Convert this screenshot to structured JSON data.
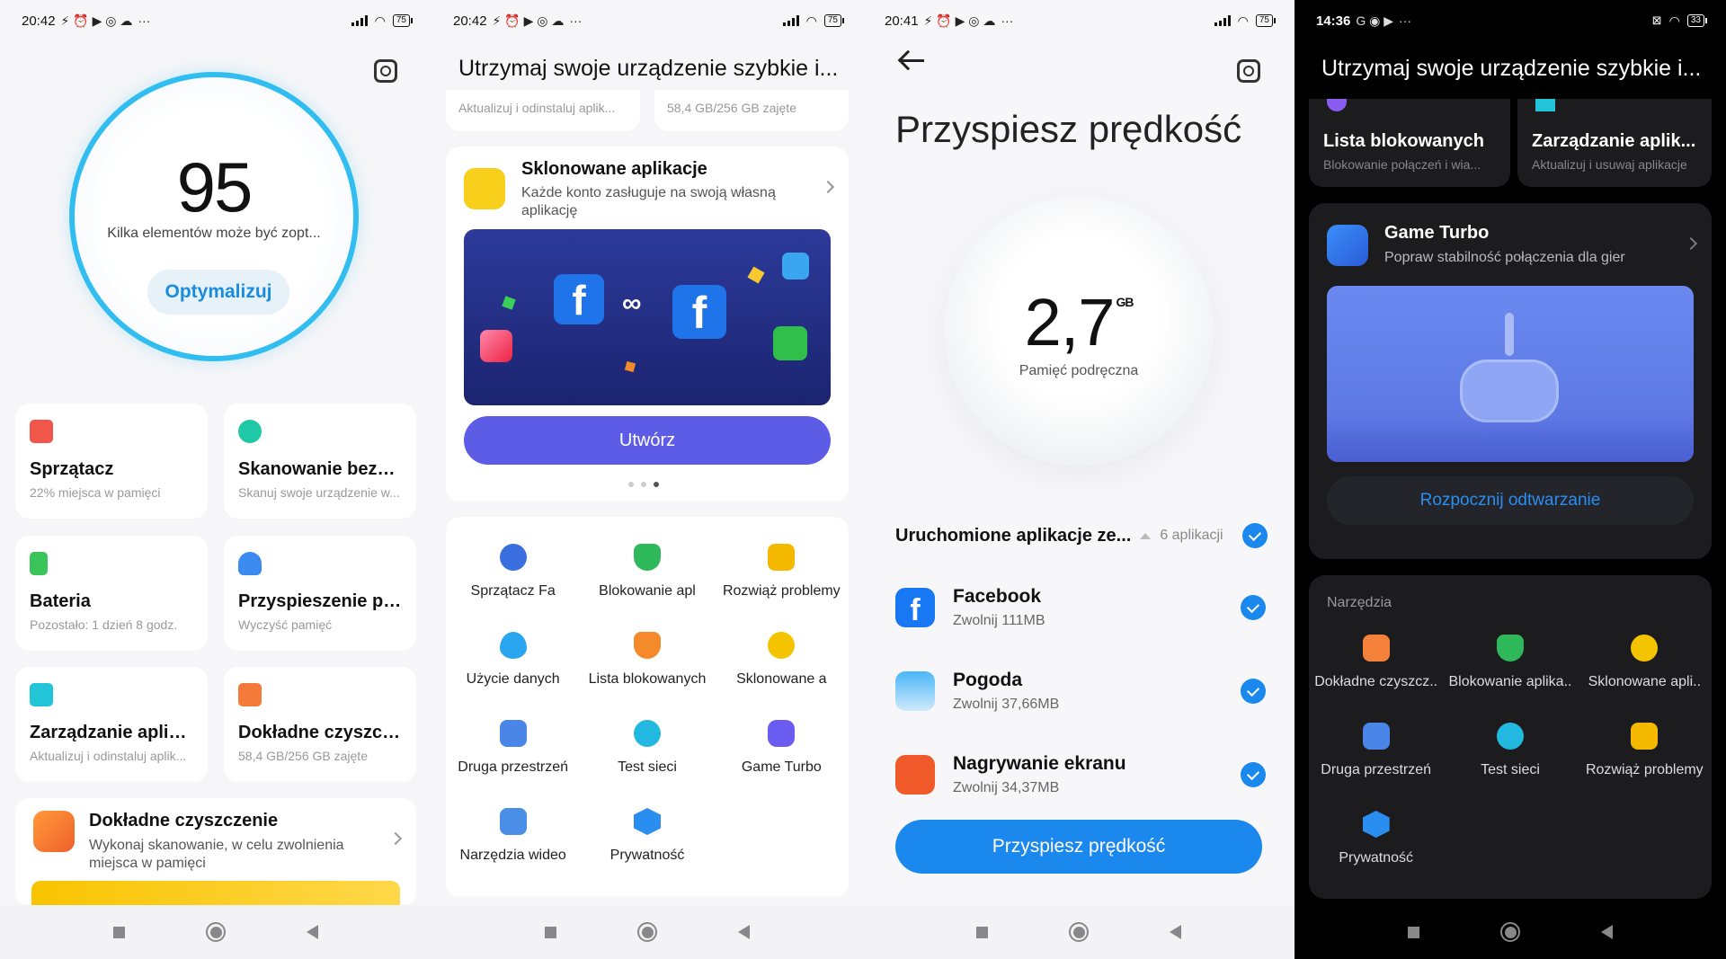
{
  "status_bar": {
    "p1_time": "20:42",
    "p2_time": "20:42",
    "p3_time": "20:41",
    "p4_time": "14:36",
    "battery_light": "75",
    "battery_dark": "33",
    "more": "···"
  },
  "panel1": {
    "score": "95",
    "score_subtitle": "Kilka elementów może być zopt...",
    "optimize_button": "Optymalizuj",
    "tiles": [
      {
        "title": "Sprzątacz",
        "subtitle": "22% miejsca w pamięci",
        "color": "#f0574a"
      },
      {
        "title": "Skanowanie bezpi...",
        "subtitle": "Skanuj swoje urządzenie w...",
        "color": "#1fc8a6"
      },
      {
        "title": "Bateria",
        "subtitle": "Pozostało: 1 dzień 8 godz.",
        "color": "#3ac45a"
      },
      {
        "title": "Przyspieszenie pr...",
        "subtitle": "Wyczyść pamięć",
        "color": "#3b8bf0"
      },
      {
        "title": "Zarządzanie aplik...",
        "subtitle": "Aktualizuj i odinstaluj aplik...",
        "color": "#22c4d8"
      },
      {
        "title": "Dokładne czyszcz...",
        "subtitle": "58,4 GB/256 GB zajęte",
        "color": "#f47a3a"
      }
    ],
    "deep_clean": {
      "title": "Dokładne czyszczenie",
      "subtitle": "Wykonaj skanowanie, w celu zwolnienia miejsca w pamięci"
    }
  },
  "panel2": {
    "header": "Utrzymaj swoje urządzenie szybkie i...",
    "mini_cards": [
      "Aktualizuj i odinstaluj aplik...",
      "58,4 GB/256 GB zajęte"
    ],
    "clone_card": {
      "title": "Sklonowane aplikacje",
      "subtitle": "Każde konto zasługuje na swoją własną aplikację",
      "button": "Utwórz"
    },
    "tools": [
      {
        "label": "Sprzątacz Fa",
        "color": "#3b6fe0"
      },
      {
        "label": "Blokowanie apl",
        "color": "#2fb85a"
      },
      {
        "label": "Rozwiąż problemy",
        "color": "#f5b800"
      },
      {
        "label": "Użycie danych",
        "color": "#2aa6f0"
      },
      {
        "label": "Lista blokowanych",
        "color": "#f58a2a"
      },
      {
        "label": "Sklonowane a",
        "color": "#f5c400"
      },
      {
        "label": "Druga przestrzeń",
        "color": "#4a86e8"
      },
      {
        "label": "Test sieci",
        "color": "#22b8e0"
      },
      {
        "label": "Game Turbo",
        "color": "#6a5cf0"
      },
      {
        "label": "Narzędzia wideo",
        "color": "#4a8ee8"
      },
      {
        "label": "Prywatność",
        "color": "#2a8ef0"
      }
    ]
  },
  "panel3": {
    "title": "Przyspiesz prędkość",
    "memory_value": "2,7",
    "memory_unit": "GB",
    "memory_label": "Pamięć podręczna",
    "section_title": "Uruchomione aplikacje ze...",
    "section_count": "6 aplikacji",
    "apps": [
      {
        "name": "Facebook",
        "freed": "Zwolnij 111MB",
        "color": "#1877f2"
      },
      {
        "name": "Pogoda",
        "freed": "Zwolnij 37,66MB",
        "color": "#3aa0f0"
      },
      {
        "name": "Nagrywanie ekranu",
        "freed": "Zwolnij 34,37MB",
        "color": "#f05a2a"
      }
    ],
    "button": "Przyspiesz prędkość"
  },
  "panel4": {
    "header": "Utrzymaj swoje urządzenie szybkie i...",
    "top_tiles": [
      {
        "title": "Lista blokowanych",
        "subtitle": "Blokowanie połączeń i wia..."
      },
      {
        "title": "Zarządzanie aplik...",
        "subtitle": "Aktualizuj i usuwaj aplikacje"
      }
    ],
    "game_turbo": {
      "title": "Game Turbo",
      "subtitle": "Popraw stabilność połączenia dla gier",
      "button": "Rozpocznij odtwarzanie"
    },
    "tools_heading": "Narzędzia",
    "tools": [
      {
        "label": "Dokładne czyszcz..",
        "color": "#f5823a"
      },
      {
        "label": "Blokowanie aplika..",
        "color": "#2fb85a"
      },
      {
        "label": "Sklonowane apli..",
        "color": "#f5c400"
      },
      {
        "label": "Druga przestrzeń",
        "color": "#4a86e8"
      },
      {
        "label": "Test sieci",
        "color": "#22b8e0"
      },
      {
        "label": "Rozwiąż problemy",
        "color": "#f5b800"
      },
      {
        "label": "Prywatność",
        "color": "#2a8ef0"
      }
    ]
  }
}
